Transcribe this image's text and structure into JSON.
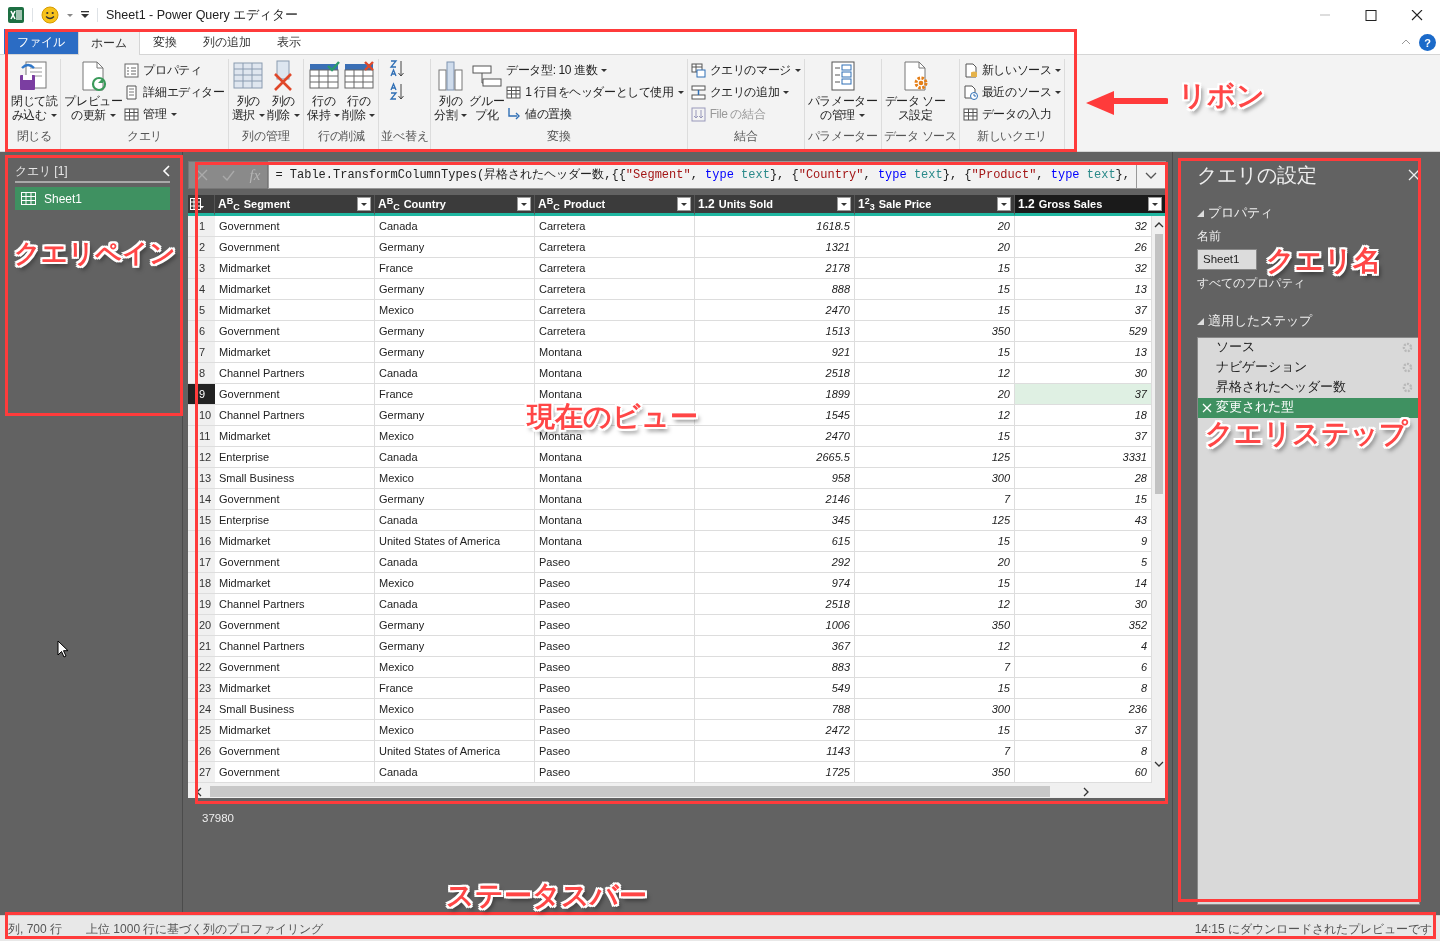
{
  "window": {
    "title": "Sheet1 - Power Query エディター"
  },
  "tabs": [
    {
      "label": "ファイル",
      "kind": "file",
      "selected": false
    },
    {
      "label": "ホーム",
      "kind": "tab",
      "selected": true
    },
    {
      "label": "変換",
      "kind": "tab",
      "selected": false
    },
    {
      "label": "列の追加",
      "kind": "tab",
      "selected": false
    },
    {
      "label": "表示",
      "kind": "tab",
      "selected": false
    }
  ],
  "help": {
    "label": "?"
  },
  "ribbon_groups": [
    {
      "label": "閉じる",
      "items": [
        {
          "kind": "large",
          "lines": [
            "閉じて読",
            "み込む"
          ],
          "dropdown": true
        }
      ]
    },
    {
      "label": "クエリ",
      "items": [
        {
          "kind": "large",
          "lines": [
            "プレビュー",
            "の更新"
          ],
          "dropdown": true
        },
        {
          "kind": "small",
          "text": "プロパティ",
          "dropdown": false,
          "disabled": false
        },
        {
          "kind": "small",
          "text": "詳細エディター",
          "dropdown": false,
          "disabled": false
        },
        {
          "kind": "small",
          "text": "管理",
          "dropdown": true,
          "disabled": false
        }
      ]
    },
    {
      "label": "列の管理",
      "items": [
        {
          "kind": "large",
          "lines": [
            "列の",
            "選択"
          ],
          "dropdown": true
        },
        {
          "kind": "large",
          "lines": [
            "列の",
            "削除"
          ],
          "dropdown": true
        }
      ]
    },
    {
      "label": "行の削減",
      "items": [
        {
          "kind": "large",
          "lines": [
            "行の",
            "保持"
          ],
          "dropdown": true
        },
        {
          "kind": "large",
          "lines": [
            "行の",
            "削除"
          ],
          "dropdown": true
        }
      ]
    },
    {
      "label": "並べ替え",
      "items": [
        {
          "kind": "sort_asc"
        },
        {
          "kind": "sort_desc"
        }
      ]
    },
    {
      "label": "変換",
      "items": [
        {
          "kind": "large",
          "lines": [
            "列の",
            "分割"
          ],
          "dropdown": true
        },
        {
          "kind": "large",
          "lines": [
            "グルー",
            "プ化"
          ],
          "dropdown": false
        },
        {
          "kind": "plain",
          "text": "データ型: 10 進数",
          "dropdown": true,
          "disabled": false
        },
        {
          "kind": "small",
          "text": "1 行目をヘッダーとして使用",
          "dropdown": true,
          "disabled": false
        },
        {
          "kind": "small",
          "text": "値の置換",
          "dropdown": false,
          "disabled": false
        }
      ]
    },
    {
      "label": "結合",
      "items": [
        {
          "kind": "small",
          "text": "クエリのマージ",
          "dropdown": true,
          "disabled": false
        },
        {
          "kind": "small",
          "text": "クエリの追加",
          "dropdown": true,
          "disabled": false
        },
        {
          "kind": "small",
          "text": "File の結合",
          "dropdown": false,
          "disabled": true
        }
      ]
    },
    {
      "label": "パラメーター",
      "items": [
        {
          "kind": "large",
          "lines": [
            "パラメーター",
            "の管理"
          ],
          "dropdown": true
        }
      ]
    },
    {
      "label": "データ ソース",
      "items": [
        {
          "kind": "large",
          "lines": [
            "データ ソー",
            "ス設定"
          ],
          "dropdown": false
        }
      ]
    },
    {
      "label": "新しいクエリ",
      "items": [
        {
          "kind": "small",
          "text": "新しいソース",
          "dropdown": true,
          "disabled": false
        },
        {
          "kind": "small",
          "text": "最近のソース",
          "dropdown": true,
          "disabled": false
        },
        {
          "kind": "small",
          "text": "データの入力",
          "dropdown": false,
          "disabled": false
        }
      ]
    }
  ],
  "query_pane": {
    "title": "クエリ [1]",
    "items": [
      {
        "label": "Sheet1",
        "selected": true
      }
    ]
  },
  "formula_bar": {
    "function_label": "fx",
    "segments": [
      {
        "kind": "plain",
        "text": "= Table.TransformColumnTypes(昇格されたヘッダー数,{{"
      },
      {
        "kind": "string",
        "text": "\"Segment\""
      },
      {
        "kind": "plain",
        "text": ", "
      },
      {
        "kind": "keyword",
        "text": "type"
      },
      {
        "kind": "typename",
        "text": " text"
      },
      {
        "kind": "plain",
        "text": "}, {"
      },
      {
        "kind": "string",
        "text": "\"Country\""
      },
      {
        "kind": "plain",
        "text": ", "
      },
      {
        "kind": "keyword",
        "text": "type"
      },
      {
        "kind": "typename",
        "text": " text"
      },
      {
        "kind": "plain",
        "text": "}, {"
      },
      {
        "kind": "string",
        "text": "\"Product\""
      },
      {
        "kind": "plain",
        "text": ", "
      },
      {
        "kind": "keyword",
        "text": "type"
      },
      {
        "kind": "typename",
        "text": " text"
      },
      {
        "kind": "plain",
        "text": "},"
      }
    ]
  },
  "table": {
    "columns": [
      {
        "type_label": "A$^{B}$$_{C}$",
        "name": "Segment",
        "kind": "text",
        "selected": false
      },
      {
        "type_label": "A$^{B}$$_{C}$",
        "name": "Country",
        "kind": "text",
        "selected": false
      },
      {
        "type_label": "A$^{B}$$_{C}$",
        "name": "Product",
        "kind": "text",
        "selected": false
      },
      {
        "type_label": "1.2",
        "name": "Units Sold",
        "kind": "number",
        "selected": false
      },
      {
        "type_label": "1$^{2}$$_{3}$",
        "name": "Sale Price",
        "kind": "number",
        "selected": false
      },
      {
        "type_label": "1.2",
        "name": "Gross Sales",
        "kind": "number",
        "selected": true
      }
    ],
    "rows": [
      {
        "n": "1",
        "cells": [
          "Government",
          "Canada",
          "Carretera",
          "1618.5",
          "20",
          "32"
        ],
        "selected": false
      },
      {
        "n": "2",
        "cells": [
          "Government",
          "Germany",
          "Carretera",
          "1321",
          "20",
          "26"
        ],
        "selected": false
      },
      {
        "n": "3",
        "cells": [
          "Midmarket",
          "France",
          "Carretera",
          "2178",
          "15",
          "32"
        ],
        "selected": false
      },
      {
        "n": "4",
        "cells": [
          "Midmarket",
          "Germany",
          "Carretera",
          "888",
          "15",
          "13"
        ],
        "selected": false
      },
      {
        "n": "5",
        "cells": [
          "Midmarket",
          "Mexico",
          "Carretera",
          "2470",
          "15",
          "37"
        ],
        "selected": false
      },
      {
        "n": "6",
        "cells": [
          "Government",
          "Germany",
          "Carretera",
          "1513",
          "350",
          "529"
        ],
        "selected": false
      },
      {
        "n": "7",
        "cells": [
          "Midmarket",
          "Germany",
          "Montana",
          "921",
          "15",
          "13"
        ],
        "selected": false
      },
      {
        "n": "8",
        "cells": [
          "Channel Partners",
          "Canada",
          "Montana",
          "2518",
          "12",
          "30"
        ],
        "selected": false
      },
      {
        "n": "9",
        "cells": [
          "Government",
          "France",
          "Montana",
          "1899",
          "20",
          "37"
        ],
        "selected": true
      },
      {
        "n": "10",
        "cells": [
          "Channel Partners",
          "Germany",
          null,
          "1545",
          "12",
          "18"
        ],
        "selected": false
      },
      {
        "n": "11",
        "cells": [
          "Midmarket",
          "Mexico",
          "Montana",
          "2470",
          "15",
          "37"
        ],
        "selected": false
      },
      {
        "n": "12",
        "cells": [
          "Enterprise",
          "Canada",
          "Montana",
          "2665.5",
          "125",
          "3331"
        ],
        "selected": false
      },
      {
        "n": "13",
        "cells": [
          "Small Business",
          "Mexico",
          "Montana",
          "958",
          "300",
          "28"
        ],
        "selected": false
      },
      {
        "n": "14",
        "cells": [
          "Government",
          "Germany",
          "Montana",
          "2146",
          "7",
          "15"
        ],
        "selected": false
      },
      {
        "n": "15",
        "cells": [
          "Enterprise",
          "Canada",
          "Montana",
          "345",
          "125",
          "43"
        ],
        "selected": false
      },
      {
        "n": "16",
        "cells": [
          "Midmarket",
          "United States of America",
          "Montana",
          "615",
          "15",
          "9"
        ],
        "selected": false
      },
      {
        "n": "17",
        "cells": [
          "Government",
          "Canada",
          "Paseo",
          "292",
          "20",
          "5"
        ],
        "selected": false
      },
      {
        "n": "18",
        "cells": [
          "Midmarket",
          "Mexico",
          "Paseo",
          "974",
          "15",
          "14"
        ],
        "selected": false
      },
      {
        "n": "19",
        "cells": [
          "Channel Partners",
          "Canada",
          "Paseo",
          "2518",
          "12",
          "30"
        ],
        "selected": false
      },
      {
        "n": "20",
        "cells": [
          "Government",
          "Germany",
          "Paseo",
          "1006",
          "350",
          "352"
        ],
        "selected": false
      },
      {
        "n": "21",
        "cells": [
          "Channel Partners",
          "Germany",
          "Paseo",
          "367",
          "12",
          "4"
        ],
        "selected": false
      },
      {
        "n": "22",
        "cells": [
          "Government",
          "Mexico",
          "Paseo",
          "883",
          "7",
          "6"
        ],
        "selected": false
      },
      {
        "n": "23",
        "cells": [
          "Midmarket",
          "France",
          "Paseo",
          "549",
          "15",
          "8"
        ],
        "selected": false
      },
      {
        "n": "24",
        "cells": [
          "Small Business",
          "Mexico",
          "Paseo",
          "788",
          "300",
          "236"
        ],
        "selected": false
      },
      {
        "n": "25",
        "cells": [
          "Midmarket",
          "Mexico",
          "Paseo",
          "2472",
          "15",
          "37"
        ],
        "selected": false
      },
      {
        "n": "26",
        "cells": [
          "Government",
          "United States of America",
          "Paseo",
          "1143",
          "7",
          "8"
        ],
        "selected": false
      },
      {
        "n": "27",
        "cells": [
          "Government",
          "Canada",
          "Paseo",
          "1725",
          "350",
          "60"
        ],
        "selected": false
      }
    ]
  },
  "value_preview": "37980",
  "settings_pane": {
    "title": "クエリの設定",
    "properties_heading": "プロパティ",
    "name_label": "名前",
    "name_value": "Sheet1",
    "all_properties": "すべてのプロパティ",
    "steps_heading": "適用したステップ",
    "steps": [
      {
        "label": "ソース",
        "selected": false
      },
      {
        "label": "ナビゲーション",
        "selected": false
      },
      {
        "label": "昇格されたヘッダー数",
        "selected": false
      },
      {
        "label": "変更された型",
        "selected": true
      }
    ]
  },
  "status_bar": {
    "left": [
      "列, 700 行",
      "上位 1000 行に基づく列のプロファイリング"
    ],
    "right": "14:15 にダウンロードされたプレビューです"
  },
  "annotations": [
    {
      "label": "リボン"
    },
    {
      "label": "クエリペイン"
    },
    {
      "label": "現在のビュー"
    },
    {
      "label": "クエリ名"
    },
    {
      "label": "クエリステップ"
    },
    {
      "label": "ステータスバー"
    }
  ]
}
